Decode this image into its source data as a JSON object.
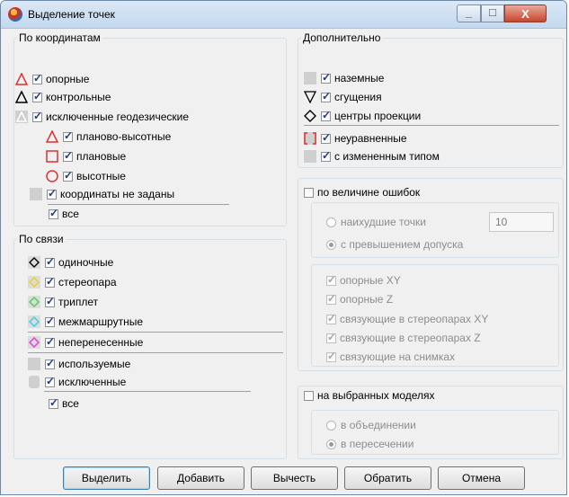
{
  "window": {
    "title": "Выделение точек",
    "minimize": "_",
    "maximize": "□",
    "close": "X"
  },
  "coords": {
    "title": "По координатам",
    "items": [
      {
        "label": "опорные",
        "checked": true
      },
      {
        "label": "контрольные",
        "checked": true
      },
      {
        "label": "исключенные геодезические",
        "checked": true
      },
      {
        "label": "планово-высотные",
        "checked": true
      },
      {
        "label": "плановые",
        "checked": true
      },
      {
        "label": "высотные",
        "checked": true
      },
      {
        "label": "координаты не заданы",
        "checked": true
      },
      {
        "label": "все",
        "checked": true
      }
    ]
  },
  "links": {
    "title": "По связи",
    "items": [
      {
        "label": "одиночные",
        "checked": true
      },
      {
        "label": "стереопара",
        "checked": true
      },
      {
        "label": "триплет",
        "checked": true
      },
      {
        "label": "межмаршрутные",
        "checked": true
      },
      {
        "label": "неперенесенные",
        "checked": true
      },
      {
        "label": "используемые",
        "checked": true
      },
      {
        "label": "исключенные",
        "checked": true
      },
      {
        "label": "все",
        "checked": true
      }
    ]
  },
  "extra": {
    "title": "Дополнительно",
    "items": [
      {
        "label": "наземные",
        "checked": true
      },
      {
        "label": "сгущения",
        "checked": true
      },
      {
        "label": "центры проекции",
        "checked": true
      },
      {
        "label": "неуравненные",
        "checked": true
      },
      {
        "label": "с измененным типом",
        "checked": true
      }
    ]
  },
  "errors": {
    "label": "по величине ошибок",
    "checked": false,
    "worst_label": "наихудшие точки",
    "worst_value": "10",
    "exceed_label": "с превышением допуска",
    "types": [
      "опорные XY",
      "опорные Z",
      "связующие в стереопарах XY",
      "связующие в стереопарах Z",
      "связующие на снимках"
    ]
  },
  "models": {
    "label": "на выбранных моделях",
    "checked": false,
    "union_label": "в объединении",
    "intersect_label": "в пересечении"
  },
  "buttons": {
    "select": "Выделить",
    "add": "Добавить",
    "subtract": "Вычесть",
    "invert": "Обратить",
    "cancel": "Отмена"
  }
}
